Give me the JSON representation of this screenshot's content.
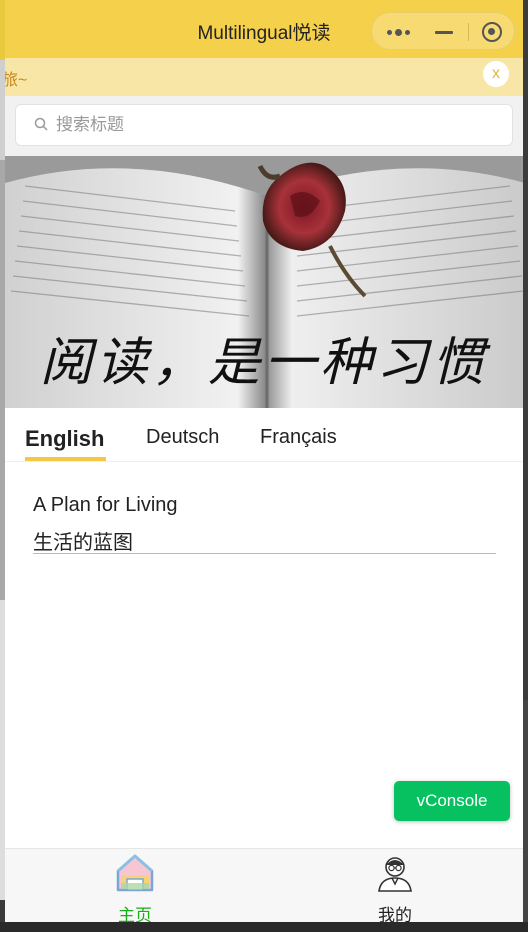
{
  "window": {
    "title": "Multilingual悦读",
    "capsule": [
      "more-dots-icon",
      "minimize-icon",
      "close-target-icon"
    ]
  },
  "notice": {
    "text": "旅~",
    "close_label": "x"
  },
  "search": {
    "placeholder": "搜索标题",
    "value": ""
  },
  "banner": {
    "caption": "阅读，是一种习惯"
  },
  "tabs": [
    {
      "label": "English",
      "active": true
    },
    {
      "label": "Deutsch",
      "active": false
    },
    {
      "label": "Français",
      "active": false
    }
  ],
  "articles": [
    {
      "title": "A Plan for Living",
      "subtitle": "生活的蓝图"
    }
  ],
  "vconsole_label": "vConsole",
  "tabbar": [
    {
      "label": "主页",
      "icon": "home-icon",
      "active": true
    },
    {
      "label": "我的",
      "icon": "profile-icon",
      "active": false
    }
  ],
  "colors": {
    "brand_yellow": "#f5d04a",
    "notice_bg": "#f8e6a6",
    "notice_text": "#c88a1a",
    "tab_underline": "#f2c845",
    "active_tabbar": "#1aad19",
    "vconsole_green": "#07c160"
  }
}
